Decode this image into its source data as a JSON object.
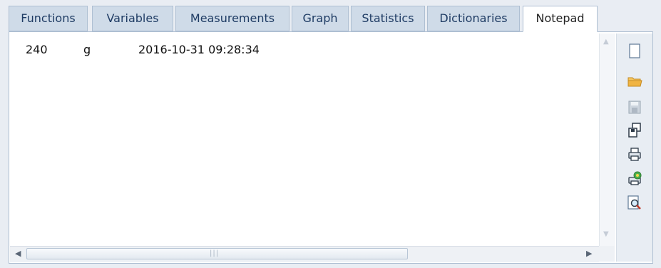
{
  "tabs": [
    {
      "label": "Functions",
      "active": false
    },
    {
      "label": "Variables",
      "active": false
    },
    {
      "label": "Measurements",
      "active": false
    },
    {
      "label": "Graph",
      "active": false
    },
    {
      "label": "Statistics",
      "active": false
    },
    {
      "label": "Dictionaries",
      "active": false
    },
    {
      "label": "Notepad",
      "active": true
    }
  ],
  "notepad": {
    "rows": [
      {
        "value": "240",
        "unit": "g",
        "timestamp": "2016-10-31 09:28:34"
      }
    ]
  },
  "toolbar": {
    "buttons": [
      {
        "icon": "new-document-icon"
      },
      {
        "icon": "open-folder-icon"
      },
      {
        "icon": "save-icon"
      },
      {
        "icon": "save-as-icon"
      },
      {
        "icon": "print-icon"
      },
      {
        "icon": "print-settings-icon"
      },
      {
        "icon": "print-preview-icon"
      }
    ]
  },
  "colors": {
    "tab_bg": "#cfdbe8",
    "tab_text": "#1f3c64",
    "panel_bg": "#ffffff",
    "folder": "#f0b443"
  }
}
